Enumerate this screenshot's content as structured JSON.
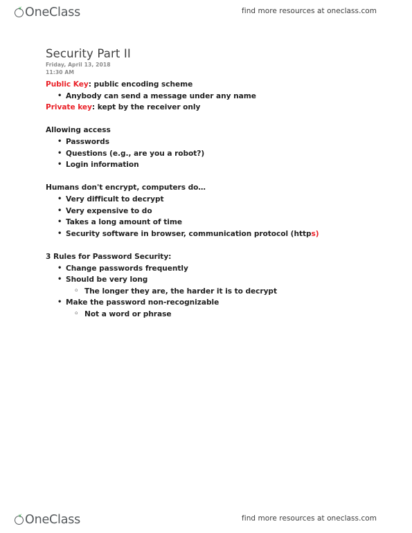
{
  "brand": {
    "name": "OneClass",
    "mark_icon": "sprout-leaf-icon",
    "leaf_color": "#2f9e44",
    "ring_color": "#55595c"
  },
  "header": {
    "tagline": "find more resources at oneclass.com"
  },
  "footer": {
    "tagline": "find more resources at oneclass.com"
  },
  "note": {
    "title": "Security Part II",
    "date": "Friday, April 13, 2018",
    "time": "11:30 AM",
    "accent_color": "#ea2027",
    "body_color": "#1f1f1f",
    "blocks": [
      {
        "lines": [
          {
            "indent": 0,
            "runs": [
              {
                "text": "Public Key",
                "color": "red"
              },
              {
                "text": ": public encoding scheme",
                "color": "body"
              }
            ]
          },
          {
            "indent": 1,
            "runs": [
              {
                "text": "Anybody can send a message under any name",
                "color": "body"
              }
            ]
          },
          {
            "indent": 0,
            "runs": [
              {
                "text": "Private key",
                "color": "red"
              },
              {
                "text": ": kept by the receiver only",
                "color": "body"
              }
            ]
          }
        ]
      },
      {
        "lines": [
          {
            "indent": 0,
            "runs": [
              {
                "text": "Allowing access",
                "color": "body"
              }
            ]
          },
          {
            "indent": 1,
            "runs": [
              {
                "text": "Passwords",
                "color": "body"
              }
            ]
          },
          {
            "indent": 1,
            "runs": [
              {
                "text": "Questions (e.g., are you a robot?)",
                "color": "body"
              }
            ]
          },
          {
            "indent": 1,
            "runs": [
              {
                "text": "Login information",
                "color": "body"
              }
            ]
          }
        ]
      },
      {
        "lines": [
          {
            "indent": 0,
            "runs": [
              {
                "text": "Humans don't encrypt, computers do…",
                "color": "body"
              }
            ]
          },
          {
            "indent": 1,
            "runs": [
              {
                "text": "Very difficult to decrypt",
                "color": "body"
              }
            ]
          },
          {
            "indent": 1,
            "runs": [
              {
                "text": "Very expensive to do",
                "color": "body"
              }
            ]
          },
          {
            "indent": 1,
            "runs": [
              {
                "text": "Takes a long amount of time",
                "color": "body"
              }
            ]
          },
          {
            "indent": 1,
            "runs": [
              {
                "text": "Security software in browser, communication protocol (http",
                "color": "body"
              },
              {
                "text": "s)",
                "color": "red"
              }
            ]
          }
        ]
      },
      {
        "lines": [
          {
            "indent": 0,
            "runs": [
              {
                "text": "3 Rules for Password Security:",
                "color": "body"
              }
            ]
          },
          {
            "indent": 1,
            "runs": [
              {
                "text": "Change passwords frequently",
                "color": "body"
              }
            ]
          },
          {
            "indent": 1,
            "runs": [
              {
                "text": "Should be very long",
                "color": "body"
              }
            ]
          },
          {
            "indent": 2,
            "runs": [
              {
                "text": "The longer they are, the harder it is to decrypt",
                "color": "body"
              }
            ]
          },
          {
            "indent": 1,
            "runs": [
              {
                "text": "Make the password non-recognizable",
                "color": "body"
              }
            ]
          },
          {
            "indent": 2,
            "runs": [
              {
                "text": "Not a word or phrase",
                "color": "body"
              }
            ]
          }
        ]
      }
    ]
  }
}
